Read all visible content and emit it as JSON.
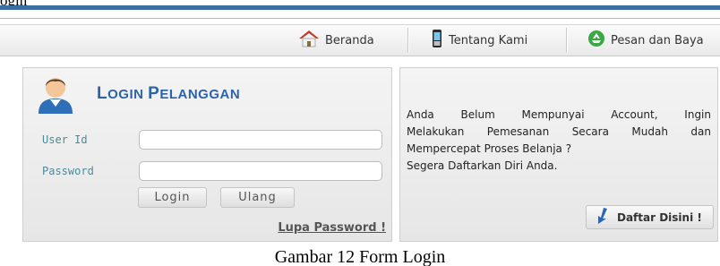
{
  "top_cut_text": "ogin",
  "nav": {
    "home_label": "Beranda",
    "about_label": "Tentang Kami",
    "order_label": "Pesan dan Baya"
  },
  "login": {
    "title_first": "L",
    "title_rest1": "OGIN ",
    "title_second": "P",
    "title_rest2": "ELANGGAN",
    "user_label": "User Id",
    "password_label": "Password",
    "user_value": "",
    "password_value": "",
    "login_button": "Login",
    "reset_button": "Ulang",
    "forgot_link": "Lupa Password !"
  },
  "info": {
    "line1": "Anda Belum Mempunyai Account, Ingin",
    "line2": "Melakukan Pemesanan Secara Mudah dan",
    "line3": "Mempercepat Proses Belanja ?",
    "line4": "Segera Daftarkan Diri Anda.",
    "register_button": "Daftar Disini !"
  },
  "caption": "Gambar 12 Form Login",
  "colors": {
    "accent": "#3d6ea3",
    "title": "#2d63a8",
    "label": "#4b8a99"
  },
  "icons": [
    "home-icon",
    "phone-icon",
    "recycle-icon",
    "user-avatar-icon",
    "arrow-down-icon"
  ]
}
